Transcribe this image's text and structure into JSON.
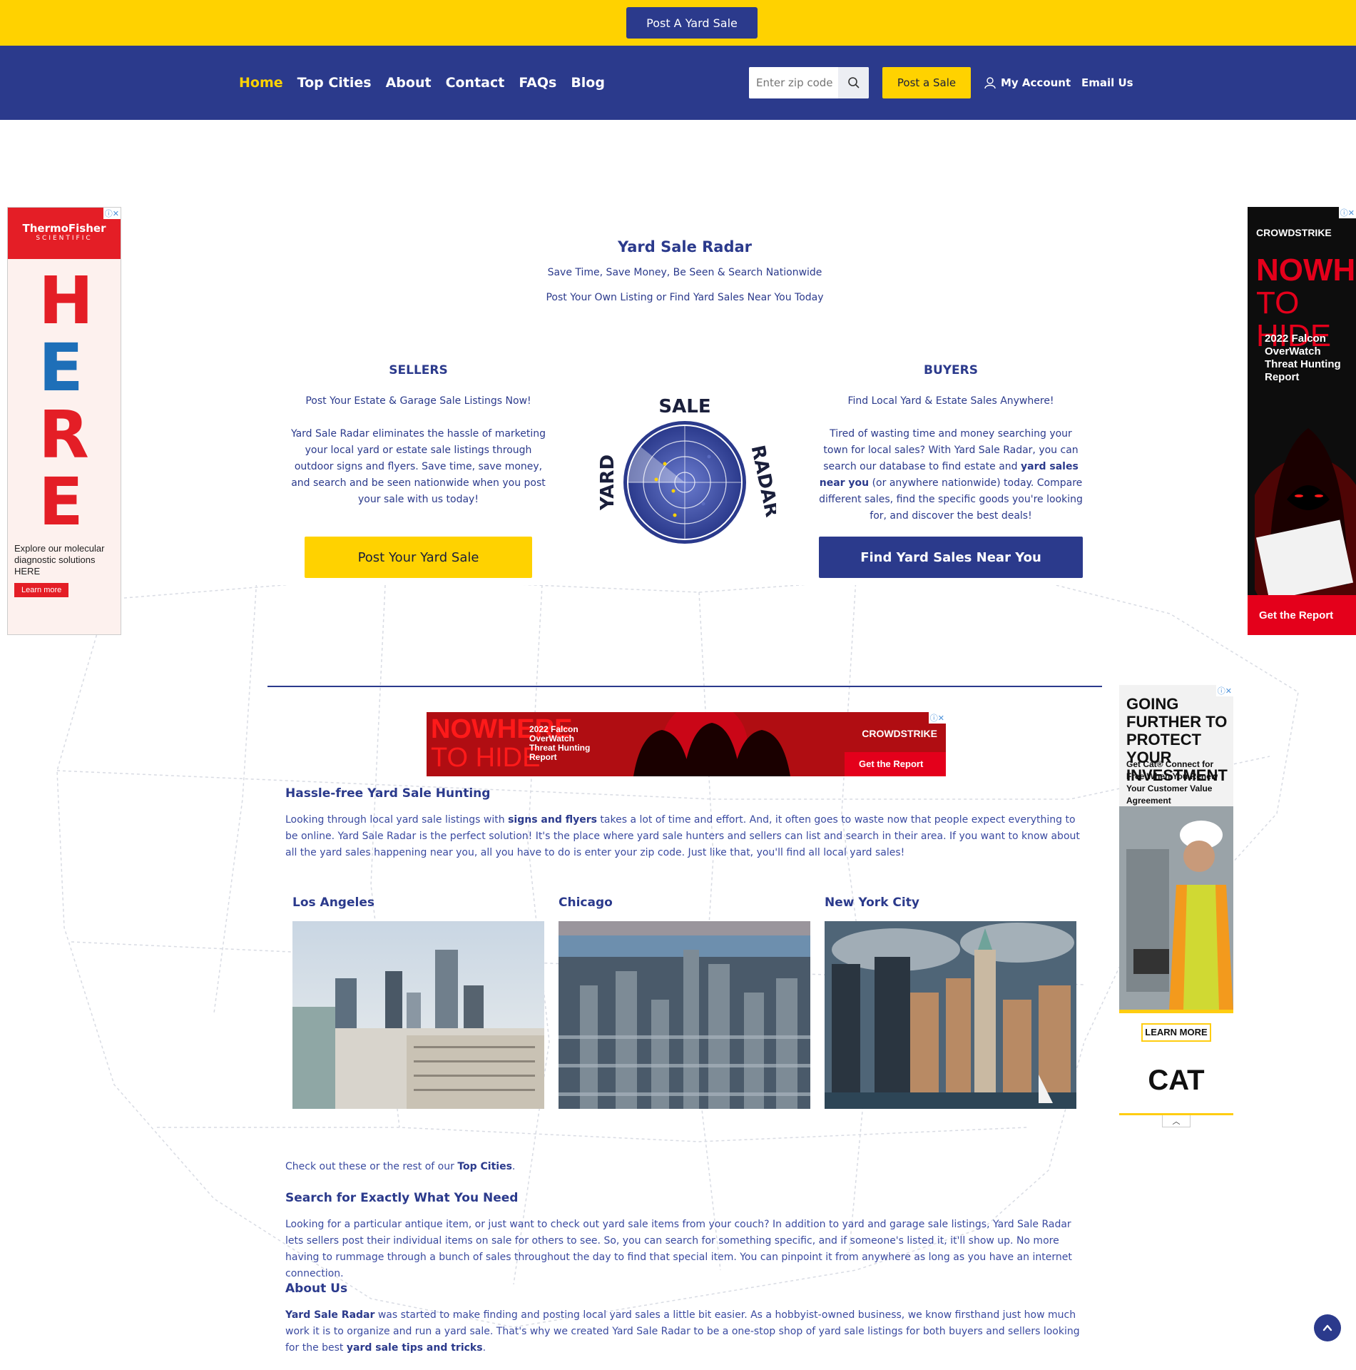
{
  "topbar": {
    "cta_label": "Post A Yard Sale"
  },
  "nav": {
    "links": [
      "Home",
      "Top Cities",
      "About",
      "Contact",
      "FAQs",
      "Blog"
    ],
    "active": "Home",
    "zip_placeholder": "Enter zip code",
    "post_sale_label": "Post a Sale",
    "account_label": "My Account",
    "email_label": "Email Us"
  },
  "hero": {
    "title": "Yard Sale Radar",
    "subtitle_1": "Save Time, Save Money, Be Seen & Search Nationwide",
    "subtitle_2": "Post Your Own Listing or Find Yard Sales Near You Today"
  },
  "sellers": {
    "heading": "SELLERS",
    "tagline": "Post Your Estate & Garage Sale Listings Now!",
    "body": "Yard Sale Radar eliminates the hassle of marketing your local yard or estate sale listings through outdoor signs and flyers. Save time, save money, and search and be seen nationwide when you post your sale with us today!",
    "button": "Post Your Yard Sale"
  },
  "buyers": {
    "heading": "BUYERS",
    "tagline": "Find Local Yard & Estate Sales Anywhere!",
    "body_1": "Tired of wasting time and money searching your town for local sales? With Yard Sale Radar, you can search our database to find estate and",
    "body_link": "yard sales near you",
    "body_2": "(or anywhere nationwide) today. Compare different sales, find the specific goods you're looking for, and discover the best deals!",
    "button": "Find Yard Sales Near You"
  },
  "logo": {
    "word_top": "SALE",
    "word_left": "YARD",
    "word_right": "RADAR"
  },
  "ads": {
    "left": {
      "brand": "ThermoFisher",
      "brand_sub": "SCIENTIFIC",
      "letters": [
        "H",
        "E",
        "R",
        "E"
      ],
      "text": "Explore our molecular diagnostic solutions HERE",
      "cta": "Learn more"
    },
    "right_top": {
      "brand": "CROWDSTRIKE",
      "headline_1": "NOWHERE",
      "headline_2": "TO HIDE",
      "text": "2022 Falcon OverWatch Threat Hunting Report",
      "cta": "Get the Report"
    },
    "banner": {
      "headline_1": "NOWHERE",
      "headline_2": "TO HIDE",
      "text": "2022 Falcon OverWatch Threat Hunting Report",
      "brand": "CROWDSTRIKE",
      "cta": "Get the Report"
    },
    "right_mid": {
      "headline": "GOING FURTHER TO PROTECT YOUR INVESTMENT",
      "text": "Get Cat® Connect for Free When You Renew Your Customer Value Agreement",
      "cta": "LEARN MORE",
      "brand": "CAT"
    }
  },
  "hunting": {
    "heading": "Hassle-free Yard Sale Hunting",
    "p_1": "Looking through local yard sale listings with",
    "p_link": "signs and flyers",
    "p_2": "takes a lot of time and effort. And, it often goes to waste now that people expect everything to be online. Yard Sale Radar is the perfect solution! It's the place where yard sale hunters and sellers can list and search in their area. If you want to know about all the yard sales happening near you, all you have to do is enter your zip code. Just like that, you'll find all local yard sales!"
  },
  "cities": [
    "Los Angeles",
    "Chicago",
    "New York City"
  ],
  "top_cities_line": {
    "before": "Check out these or the rest of our",
    "link": "Top Cities",
    "after": "."
  },
  "search": {
    "heading": "Search for Exactly What You Need",
    "body": "Looking for a particular antique item, or just want to check out yard sale items from your couch? In addition to yard and garage sale listings, Yard Sale Radar lets sellers post their individual items on sale for others to see. So, you can search for something specific, and if someone's listed it, it'll show up. No more having to rummage through a bunch of sales throughout the day to find that special item. You can pinpoint it from anywhere as long as you have an internet connection."
  },
  "about": {
    "heading": "About Us",
    "brand": "Yard Sale Radar",
    "p_1": "was started to make finding and posting local yard sales a little bit easier. As a hobbyist-owned business, we know firsthand just how much work it is to organize and run a yard sale. That's why we created Yard Sale Radar to be a one-stop shop of yard sale listings for both buyers and sellers looking for the best",
    "link": "yard sale tips and tricks",
    "p_2": "."
  },
  "colors": {
    "brand_blue": "#2b3a8c",
    "brand_yellow": "#ffd200"
  }
}
